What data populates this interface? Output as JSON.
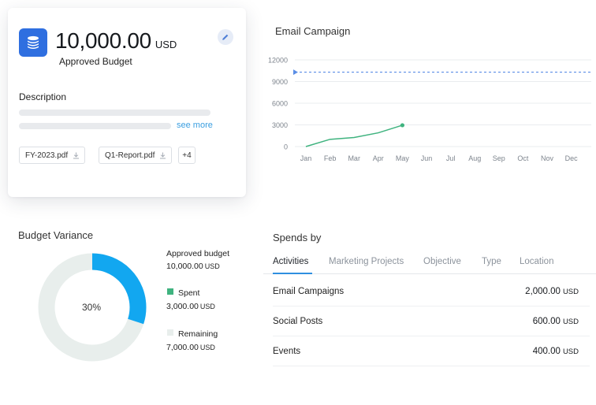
{
  "budget_card": {
    "amount": "10,000.00",
    "currency": "USD",
    "amount_label": "Approved Budget",
    "description_title": "Description",
    "see_more": "see more",
    "files": [
      "FY-2023.pdf",
      "Q1-Report.pdf"
    ],
    "more_files": "+4",
    "icons": {
      "badge": "coins-icon",
      "edit": "pencil-icon",
      "download": "download-icon"
    },
    "accent_color": "#2f6fe0"
  },
  "email_campaign": {
    "title": "Email Campaign"
  },
  "chart_data": {
    "type": "line",
    "title": "Email Campaign",
    "categories": [
      "Jan",
      "Feb",
      "Mar",
      "Apr",
      "May",
      "Jun",
      "Jul",
      "Aug",
      "Sep",
      "Oct",
      "Nov",
      "Dec"
    ],
    "yticks": [
      "12000",
      "9000",
      "6000",
      "3000",
      "0"
    ],
    "ylim": [
      0,
      12000
    ],
    "series": [
      {
        "values": [
          0,
          1000,
          1250,
          1900,
          2950
        ],
        "color": "#3fb37f"
      }
    ],
    "target_line": {
      "value": 10300,
      "color": "#5b8ee6",
      "style": "dashed"
    },
    "grid": "horizontal"
  },
  "budget_variance": {
    "title": "Budget Variance",
    "center_label": "30%",
    "spent_fraction": 0.3,
    "approved_label": "Approved budget",
    "approved_value": "10,000.00",
    "spent_label": "Spent",
    "spent_value": "3,000.00",
    "remaining_label": "Remaining",
    "remaining_value": "7,000.00",
    "unit": "USD",
    "spent_color": "#12a7f0",
    "spent_legend_color": "#3fb37f",
    "remaining_color": "#e8eeec"
  },
  "spends_by": {
    "title": "Spends by",
    "tabs": [
      "Activities",
      "Marketing Projects",
      "Objective",
      "Type",
      "Location"
    ],
    "active_tab": "Activities",
    "unit": "USD",
    "rows": [
      {
        "name": "Email Campaigns",
        "value": "2,000.00"
      },
      {
        "name": "Social Posts",
        "value": "600.00"
      },
      {
        "name": "Events",
        "value": "400.00"
      }
    ]
  }
}
